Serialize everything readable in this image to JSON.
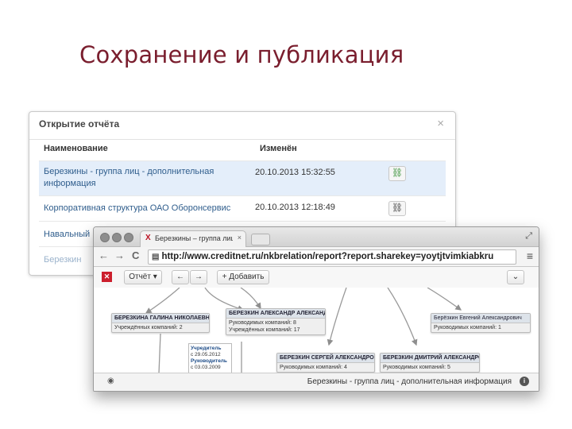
{
  "slide": {
    "title": "Сохранение и публикация"
  },
  "dialog": {
    "title": "Открытие отчёта",
    "close_icon": "×",
    "columns": {
      "name": "Наименование",
      "modified": "Изменён"
    },
    "rows": [
      {
        "name": "Березкины - группа лиц - дополнительная информация",
        "date": "20.10.2013 15:32:55",
        "selected": true
      },
      {
        "name": "Корпоративная структура ОАО Оборонсервис",
        "date": "20.10.2013 12:18:49",
        "selected": false
      },
      {
        "name": "Навальный",
        "date": "",
        "selected": false
      },
      {
        "name": "Березкин",
        "date": "",
        "selected": false
      }
    ],
    "link_icon": "⛓"
  },
  "browser": {
    "tab_title": "Березкины – группа лиц",
    "tab_close": "×",
    "tab_favicon": "X",
    "url": "http://www.creditnet.ru/nkbrelation/report?report.sharekey=yoytjtvimkiabkru",
    "nav": {
      "back": "←",
      "forward": "→",
      "reload": "C",
      "menu": "≡",
      "expand": "⤢",
      "url_icon": "▤"
    },
    "toolbar": {
      "logo": "✕",
      "report_label": "Отчёт ▾",
      "back_arrow": "←",
      "forward_arrow": "→",
      "add_label": "+ Добавить",
      "collapse": "⌄"
    },
    "graph": {
      "nodes": [
        {
          "title": "БЕРЕЗКИНА ГАЛИНА НИКОЛАЕВНА",
          "lines": [
            "Учреждённых компаний: 2"
          ]
        },
        {
          "title": "БЕРЕЗКИН АЛЕКСАНДР АЛЕКСАНДРОВИЧ",
          "lines": [
            "Руководимых компаний: 8",
            "Учреждённых компаний: 17"
          ]
        },
        {
          "title": "Берёзкин Евгений Александрович",
          "lines": [
            "Руководимых компаний: 1"
          ]
        },
        {
          "title": "БЕРЕЗКИН СЕРГЕЙ АЛЕКСАНДРОВИЧ",
          "lines": [
            "Руководимых компаний: 4"
          ]
        },
        {
          "title": "БЕРЕЗКИН ДМИТРИЙ АЛЕКСАНДРОВИЧ",
          "lines": [
            "Руководимых компаний: 5"
          ]
        }
      ],
      "note": {
        "role1": "Учредитель",
        "date1": "с 29.05.2012",
        "role2": "Руководитель",
        "date2": "с 03.03.2009"
      }
    },
    "status": {
      "text": "Березкины - группа лиц - дополнительная информация",
      "info": "i",
      "eye": "◉"
    }
  }
}
